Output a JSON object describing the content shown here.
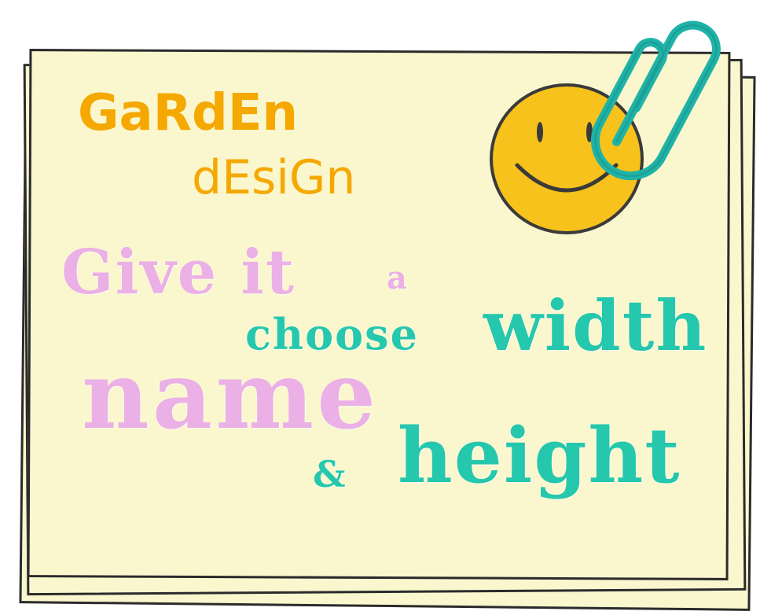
{
  "note": {
    "title_line1": "GaRdEn",
    "title_line2": "dEsiGn",
    "words": {
      "give_it": "Give it",
      "a": "a",
      "choose": "choose",
      "width": "width",
      "name": "name",
      "ampersand": "&",
      "height": "height"
    }
  },
  "colors": {
    "card_fill": "#faf7cf",
    "card_border": "#2b2b2b",
    "title": "#f5a800",
    "pink_chalk": "#ebb0e6",
    "teal_chalk": "#25c7ad",
    "smiley_face": "#f6c21b",
    "paperclip": "#1fb3a8"
  },
  "decorations": {
    "smiley": "smiley-face-icon",
    "clip": "paperclip-icon"
  }
}
